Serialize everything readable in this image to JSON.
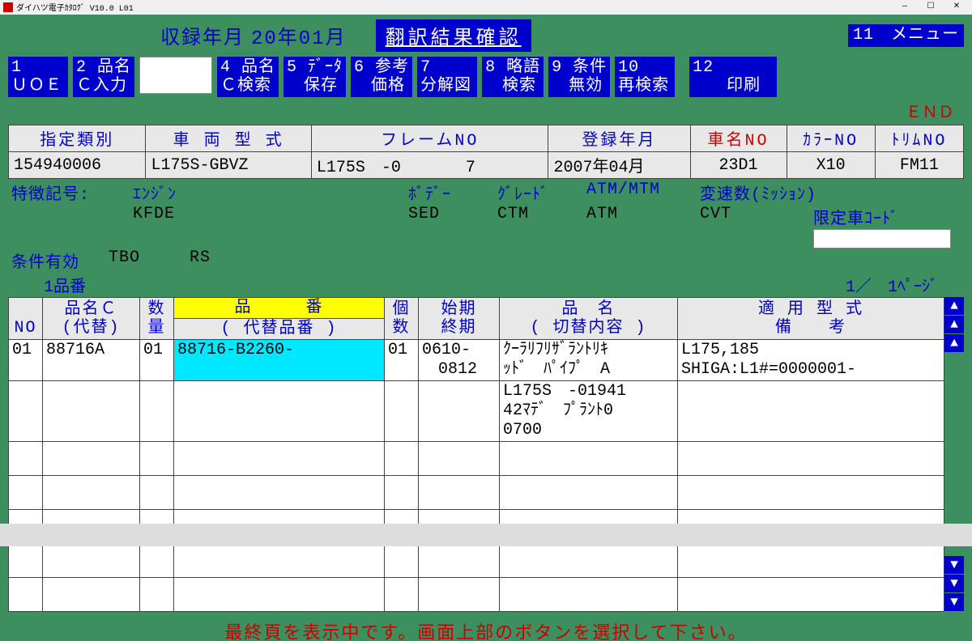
{
  "titlebar": {
    "text": "ダイハツ電子ｶﾀﾛｸﾞ V10.0 L01"
  },
  "header": {
    "label": "収録年月",
    "value": "20年01月",
    "banner": "翻訳結果確認",
    "menu11": "11　メニュー"
  },
  "fn": {
    "f1": "1\nＵＯＥ",
    "f2": "2 品名\nＣ入力",
    "f4": "4 品名\nＣ検索",
    "f5": "5 ﾃﾞｰﾀ\n　保存",
    "f6": "6 参考\n　価格",
    "f7": "7\n分解図",
    "f8": "8 略語\n　検索",
    "f9": "9 条件\n　無効",
    "f10": "10\n再検索",
    "f12": "12\n　　印刷"
  },
  "end": "ＥＮＤ",
  "info": {
    "headers": [
      "指定類別",
      "車 両 型 式",
      "フレームNO",
      "登録年月",
      "車名NO",
      "ｶﾗｰNO",
      "ﾄﾘﾑNO"
    ],
    "values": [
      "154940006",
      "L175S-GBVZ",
      "L175S　-0　　　　7",
      "2007年04月",
      "23D1",
      "X10",
      "FM11"
    ]
  },
  "meta": {
    "row1_label": "特徴記号:",
    "row1_a": "ｴﾝｼﾞﾝ",
    "row1_b": "ﾎﾞﾃﾞｰ",
    "row1_c": "ｸﾞﾚｰﾄﾞ",
    "row1_d": "ATM/MTM",
    "row1_e": "変速数(ﾐｯｼｮﾝ)",
    "row2_a": "KFDE",
    "row2_b": "SED",
    "row2_c": "CTM",
    "row2_d": "ATM",
    "row2_e": "CVT",
    "row2_limit": "限定車ｺｰﾄﾞ",
    "row3_label": "条件有効",
    "row3_a": "TBO",
    "row3_b": "RS",
    "row4": "1品番",
    "page": "1／　1ﾍﾟｰｼﾞ"
  },
  "table": {
    "h_no": "\nNO",
    "h_hinmei": "品名Ｃ\n(代替)",
    "h_qty": "数\n量",
    "h_hinban_top": "品　　　番",
    "h_hinban_bot": "( 代替品番 )",
    "h_kosu": "個\n数",
    "h_period": "始期\n終期",
    "h_name": "品　名\n( 切替内容 )",
    "h_model": "適 用 型 式\n備　　考",
    "rows": [
      {
        "no": "01",
        "hinmei": "88716A",
        "qty": "01",
        "hinban": "88716-B2260-",
        "kosu": "01",
        "period": "0610-\n　0812",
        "name": "ｸｰﾗﾘﾌﾘｻﾞﾗﾝﾄﾘｷ\nｯﾄﾞ　ﾊﾟｲﾌﾟ　A",
        "model": "L175,185\nSHIGA:L1#=0000001-"
      },
      {
        "no": "",
        "hinmei": "",
        "qty": "",
        "hinban": "",
        "kosu": "",
        "period": "",
        "name": "L175S　-01941\n42ﾏﾃﾞ　ﾌﾟﾗﾝﾄ0\n0700",
        "model": ""
      }
    ]
  },
  "footer": "最終頁を表示中です。画面上部のボタンを選択して下さい。",
  "scroll": {
    "up": "▲",
    "down": "▼"
  }
}
